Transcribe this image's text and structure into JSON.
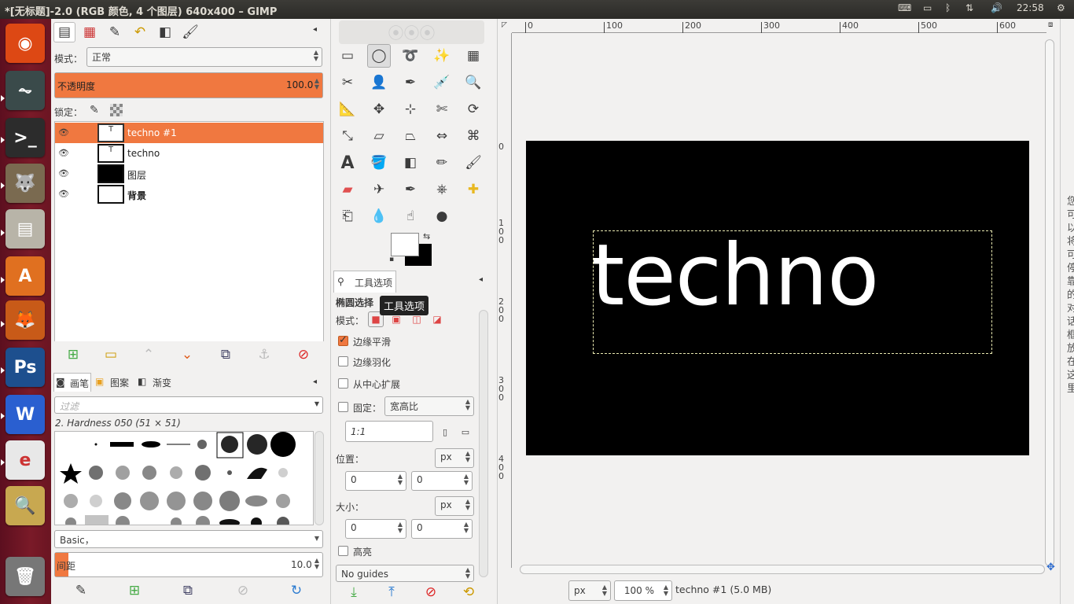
{
  "window": {
    "title": "*[无标题]-2.0 (RGB 颜色, 4 个图层) 640x400 – GIMP",
    "clock": "22:58"
  },
  "launcher": {
    "items": [
      {
        "name": "ubuntu-logo-icon",
        "glyph": "◉",
        "bg": "#dd4814"
      },
      {
        "name": "system-monitor-icon",
        "glyph": "⏦",
        "bg": "#3a4a4a"
      },
      {
        "name": "terminal-icon",
        "glyph": ">_",
        "bg": "#2c2c2c"
      },
      {
        "name": "gimp-icon",
        "glyph": "🐺",
        "bg": "#7a6a50"
      },
      {
        "name": "file-manager-icon",
        "glyph": "▤",
        "bg": "#b8b4a8"
      },
      {
        "name": "software-center-icon",
        "glyph": "A",
        "bg": "#e07020"
      },
      {
        "name": "firefox-icon",
        "glyph": "🦊",
        "bg": "#c85a18"
      },
      {
        "name": "photoshop-icon",
        "glyph": "Ps",
        "bg": "#1d4f8e"
      },
      {
        "name": "wps-writer-icon",
        "glyph": "W",
        "bg": "#2a5fd0"
      },
      {
        "name": "wps-pdf-icon",
        "glyph": "e",
        "bg": "#e8e8e8"
      },
      {
        "name": "image-viewer-icon",
        "glyph": "🔍",
        "bg": "#c8a850"
      },
      {
        "name": "trash-icon",
        "glyph": "🗑",
        "bg": "#777"
      }
    ]
  },
  "layers_panel": {
    "mode_label": "模式：",
    "mode_value": "正常",
    "opacity_label": "不透明度",
    "opacity_value": "100.0",
    "opacity_fraction": 1.0,
    "lock_label": "锁定：",
    "layers": [
      {
        "name": "techno #1",
        "selected": true
      },
      {
        "name": "techno",
        "selected": false
      },
      {
        "name": "图层",
        "selected": false
      },
      {
        "name": "背景",
        "selected": false,
        "bold": true
      }
    ]
  },
  "brushes_panel": {
    "tabs": [
      "画笔",
      "图案",
      "渐变"
    ],
    "filter_placeholder": "过滤",
    "brush_name": "2. Hardness 050 (51 × 51)",
    "tag_value": "Basic，",
    "spacing_label": "间距",
    "spacing_value": "10.0",
    "spacing_fraction": 0.1
  },
  "toolbox": {
    "tooltip": "工具选项"
  },
  "tool_options": {
    "tab_label": "工具选项",
    "tool_name": "椭圆选择",
    "mode_label": "模式：",
    "antialias_label": "边缘平滑",
    "feather_label": "边缘羽化",
    "expand_label": "从中心扩展",
    "fixed_label": "固定：",
    "fixed_value": "宽高比",
    "ratio_value": "1:1",
    "position_label": "位置：",
    "position_unit": "px",
    "pos_x": "0",
    "pos_y": "0",
    "size_label": "大小：",
    "size_unit": "px",
    "size_w": "0",
    "size_h": "0",
    "highlight_label": "高亮",
    "guides_value": "No guides"
  },
  "canvas": {
    "text": "techno",
    "ruler_top": [
      "0",
      "100",
      "200",
      "300",
      "400",
      "500",
      "600"
    ],
    "ruler_left": [
      "100",
      "200",
      "300",
      "400"
    ]
  },
  "statusbar": {
    "unit": "px",
    "zoom": "100 %",
    "info": "techno #1 (5.0 MB)"
  },
  "right_panel": {
    "text": [
      "您",
      "可",
      "以",
      "将",
      "可",
      "停",
      "靠",
      "的",
      "对",
      "话",
      "框",
      "放",
      "在",
      "这",
      "里"
    ]
  }
}
